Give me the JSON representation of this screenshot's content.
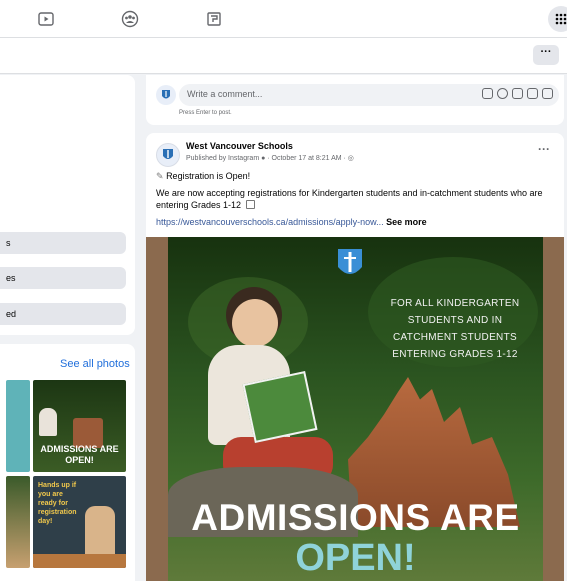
{
  "left_panel": {
    "items": [
      {
        "label": "s"
      },
      {
        "label": "es"
      },
      {
        "label": "ed"
      }
    ],
    "photos": {
      "see_all": "See all photos",
      "thumb_texts": [
        "ADMISSIONS ARE OPEN!",
        "Hands up if you are ready for registration day!"
      ]
    }
  },
  "comment": {
    "placeholder": "Write a comment...",
    "hint": "Press Enter to post."
  },
  "post": {
    "author": "West Vancouver Schools",
    "meta": "Published by Instagram ● · October 17 at 8:21 AM · ◎",
    "headline": "Registration is Open!",
    "body": "We are now accepting registrations for Kindergarten students and in-catchment students who are entering Grades 1-12",
    "link": "https://westvancouverschools.ca/admissions/apply-now...",
    "see_more": "See more",
    "image": {
      "lines": [
        "FOR ALL KINDERGARTEN",
        "STUDENTS AND IN",
        "CATCHMENT STUDENTS",
        "ENTERING GRADES 1-12"
      ],
      "admissions": "ADMISSIONS ARE",
      "open": "OPEN!"
    }
  },
  "colors": {
    "link": "#216fdb",
    "open_text": "#8fd3d9",
    "frame_brown": "#8b6a4e"
  }
}
